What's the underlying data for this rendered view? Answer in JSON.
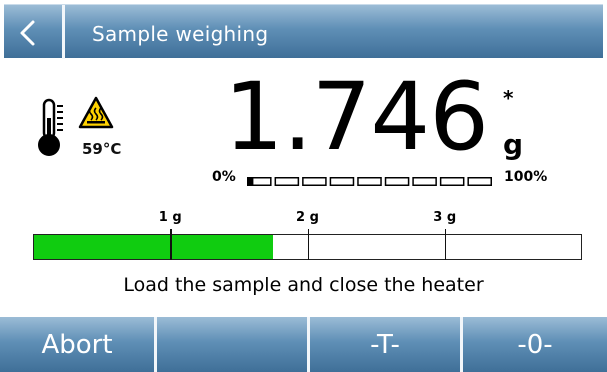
{
  "header": {
    "title": "Sample weighing",
    "back_icon": "chevron-left-icon"
  },
  "status": {
    "temperature": "59°C",
    "thermometer_icon": "thermometer-icon",
    "hot_surface_icon": "hot-surface-warning-icon"
  },
  "weight": {
    "value": "1.746",
    "unit": "g",
    "stability_mark": "*"
  },
  "progress": {
    "min_label": "0%",
    "max_label": "100%",
    "segments": 9,
    "fraction": 0.02
  },
  "weighing_bar": {
    "ticks": [
      {
        "label": "1 g",
        "value": 1
      },
      {
        "label": "2 g",
        "value": 2
      },
      {
        "label": "3 g",
        "value": 3
      }
    ],
    "range_max": 4,
    "current_value": 1.746,
    "fill_color": "#10cc10"
  },
  "message": "Load the sample and close the heater",
  "toolbar": {
    "abort_label": "Abort",
    "empty_label": "",
    "tare_label": "-T-",
    "zero_label": "-0-"
  },
  "colors": {
    "header_top": "#9bbcd6",
    "header_bottom": "#3f6f98"
  }
}
